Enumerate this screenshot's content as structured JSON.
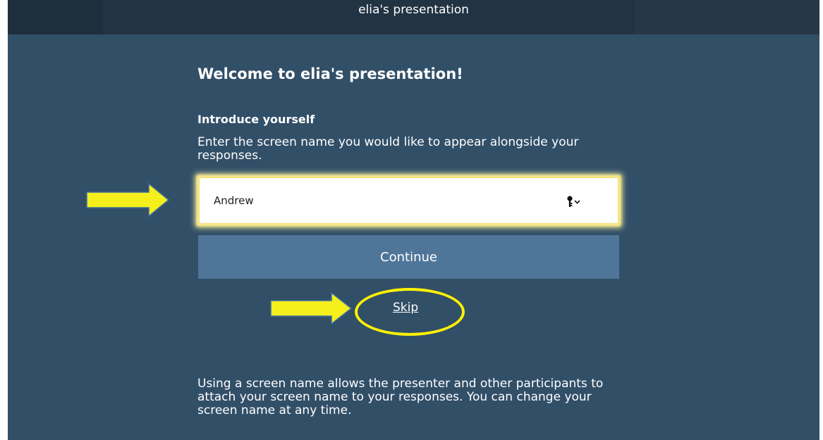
{
  "header": {
    "title": "elia's presentation"
  },
  "main": {
    "heading": "Welcome to elia's presentation!",
    "subheading": "Introduce yourself",
    "instructions": "Enter the screen name you would like to appear alongside your responses.",
    "screen_name_value": "Andrew",
    "continue_label": "Continue",
    "skip_label": "Skip",
    "footer_text": "Using a screen name allows the presenter and other participants to attach your screen name to your responses. You can change your screen name at any time."
  },
  "icons": {
    "key_dropdown": "key-icon",
    "arrow": "right-arrow-annotation"
  },
  "colors": {
    "background": "#324f68",
    "topbar": "#223344",
    "button": "#4f7699",
    "highlight": "#fff200"
  }
}
